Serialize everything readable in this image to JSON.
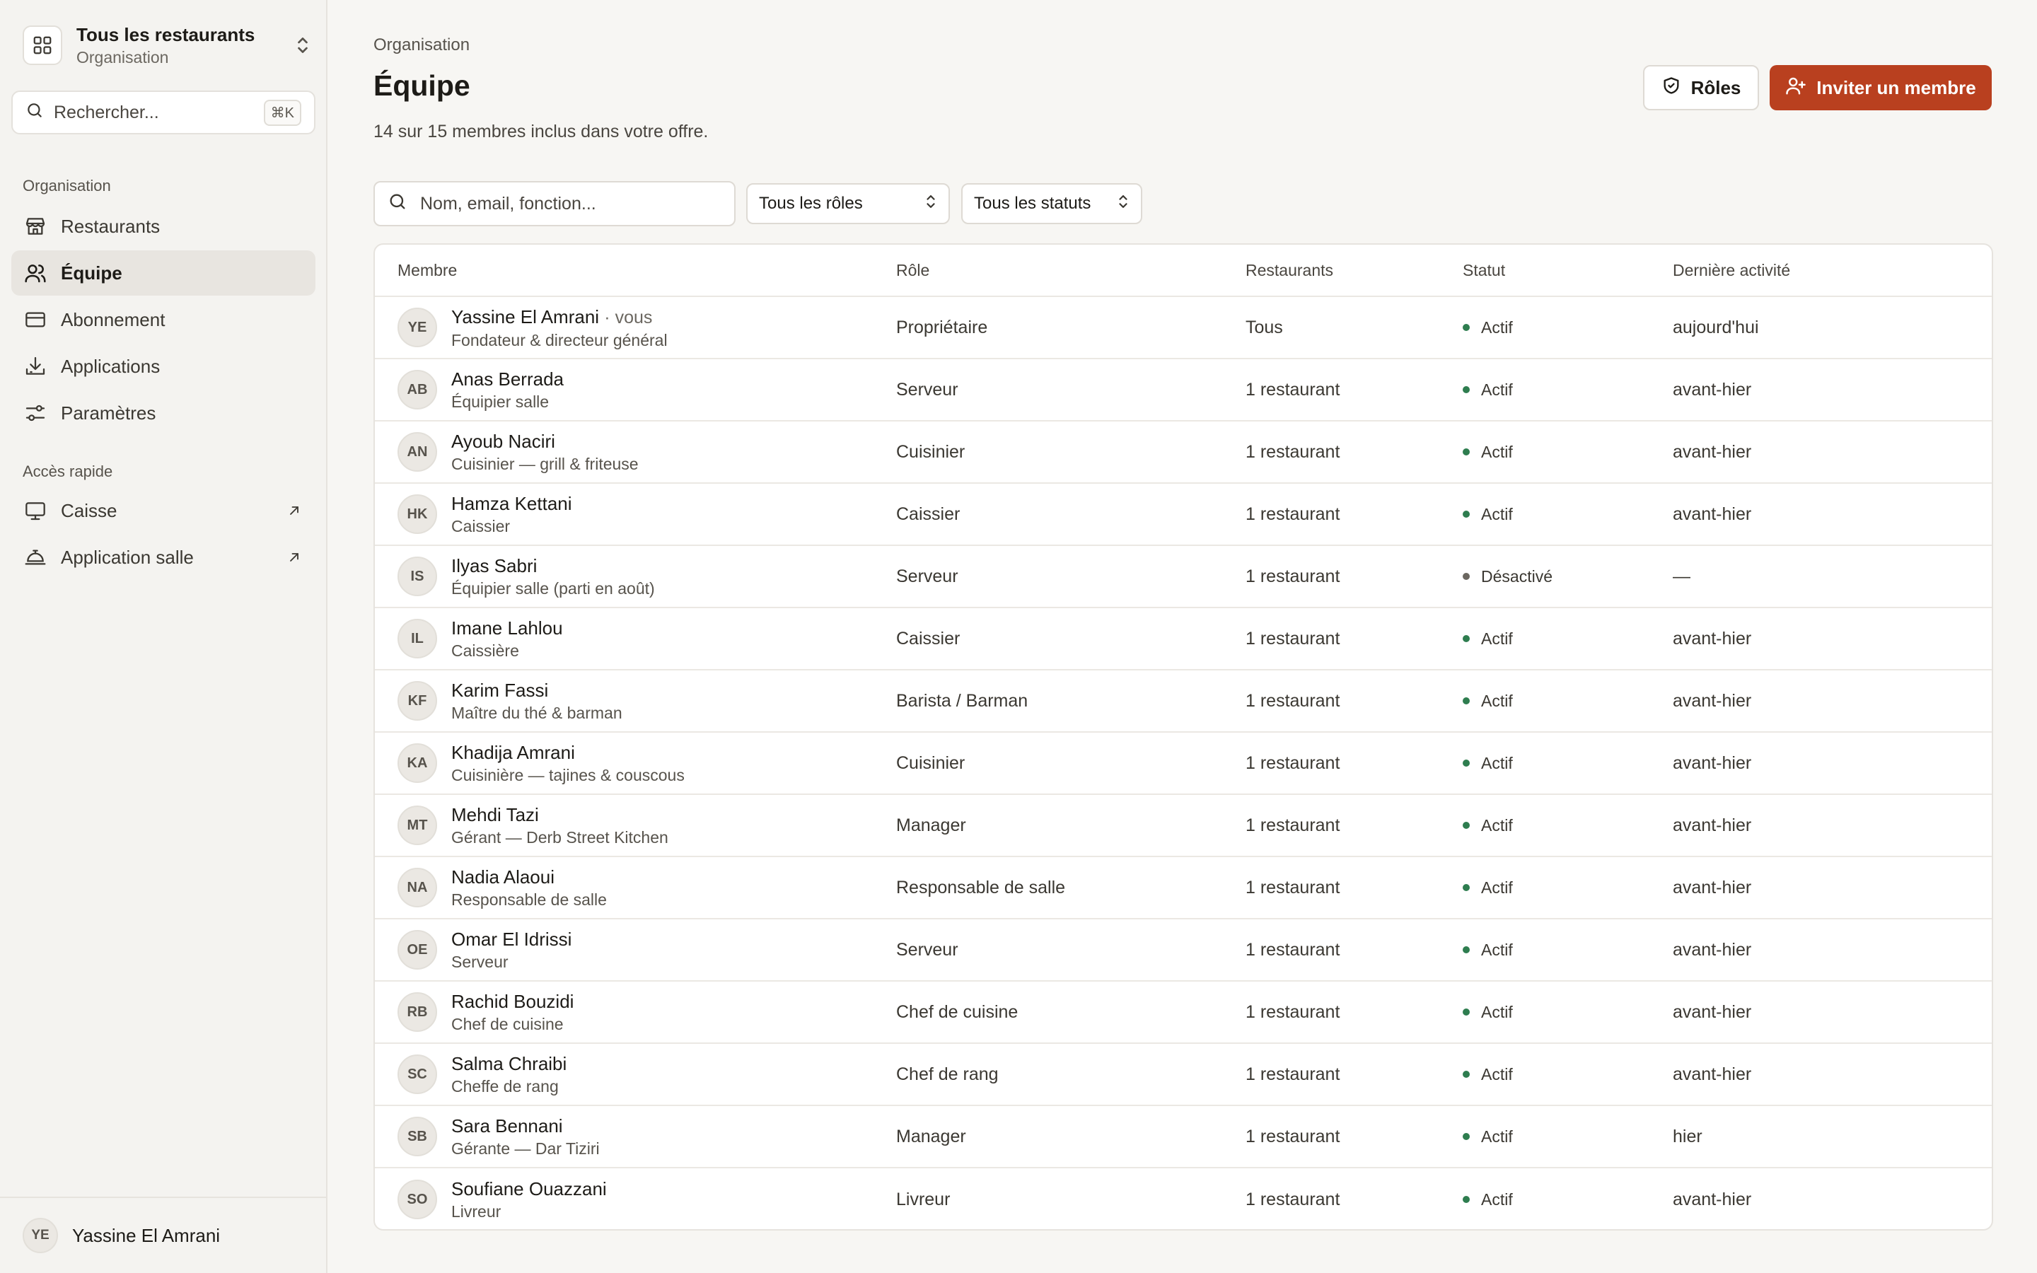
{
  "colors": {
    "accent": "#b9401f",
    "active_dot": "#2e7d4f",
    "inactive_dot": "#6b6760"
  },
  "sidebar": {
    "workspace": {
      "title": "Tous les restaurants",
      "subtitle": "Organisation",
      "icon": "grid-icon"
    },
    "search": {
      "placeholder": "Rechercher...",
      "shortcut": "⌘K"
    },
    "section_org": "Organisation",
    "nav": [
      {
        "label": "Restaurants",
        "icon": "store-icon"
      },
      {
        "label": "Équipe",
        "icon": "users-icon",
        "active": true
      },
      {
        "label": "Abonnement",
        "icon": "credit-card-icon"
      },
      {
        "label": "Applications",
        "icon": "download-icon"
      },
      {
        "label": "Paramètres",
        "icon": "sliders-icon"
      }
    ],
    "section_quick": "Accès rapide",
    "quick": [
      {
        "label": "Caisse",
        "icon": "monitor-icon"
      },
      {
        "label": "Application salle",
        "icon": "cloche-icon"
      }
    ],
    "user": {
      "initials": "YE",
      "name": "Yassine El Amrani"
    }
  },
  "main": {
    "breadcrumb": "Organisation",
    "title": "Équipe",
    "subtitle": "14 sur 15 membres inclus dans votre offre.",
    "roles_button": "Rôles",
    "invite_button": "Inviter un membre",
    "filters": {
      "search_placeholder": "Nom, email, fonction...",
      "role_select": "Tous les rôles",
      "status_select": "Tous les statuts"
    },
    "table": {
      "headers": [
        "Membre",
        "Rôle",
        "Restaurants",
        "Statut",
        "Dernière activité"
      ],
      "rows": [
        {
          "initials": "YE",
          "name": "Yassine El Amrani",
          "you": "· vous",
          "function": "Fondateur & directeur général",
          "role": "Propriétaire",
          "restaurants": "Tous",
          "status": "Actif",
          "activity": "aujourd'hui"
        },
        {
          "initials": "AB",
          "name": "Anas Berrada",
          "function": "Équipier salle",
          "role": "Serveur",
          "restaurants": "1 restaurant",
          "status": "Actif",
          "activity": "avant-hier"
        },
        {
          "initials": "AN",
          "name": "Ayoub Naciri",
          "function": "Cuisinier — grill & friteuse",
          "role": "Cuisinier",
          "restaurants": "1 restaurant",
          "status": "Actif",
          "activity": "avant-hier"
        },
        {
          "initials": "HK",
          "name": "Hamza Kettani",
          "function": "Caissier",
          "role": "Caissier",
          "restaurants": "1 restaurant",
          "status": "Actif",
          "activity": "avant-hier"
        },
        {
          "initials": "IS",
          "name": "Ilyas Sabri",
          "function": "Équipier salle (parti en août)",
          "role": "Serveur",
          "restaurants": "1 restaurant",
          "status": "Désactivé",
          "activity": "—"
        },
        {
          "initials": "IL",
          "name": "Imane Lahlou",
          "function": "Caissière",
          "role": "Caissier",
          "restaurants": "1 restaurant",
          "status": "Actif",
          "activity": "avant-hier"
        },
        {
          "initials": "KF",
          "name": "Karim Fassi",
          "function": "Maître du thé & barman",
          "role": "Barista / Barman",
          "restaurants": "1 restaurant",
          "status": "Actif",
          "activity": "avant-hier"
        },
        {
          "initials": "KA",
          "name": "Khadija Amrani",
          "function": "Cuisinière — tajines & couscous",
          "role": "Cuisinier",
          "restaurants": "1 restaurant",
          "status": "Actif",
          "activity": "avant-hier"
        },
        {
          "initials": "MT",
          "name": "Mehdi Tazi",
          "function": "Gérant — Derb Street Kitchen",
          "role": "Manager",
          "restaurants": "1 restaurant",
          "status": "Actif",
          "activity": "avant-hier"
        },
        {
          "initials": "NA",
          "name": "Nadia Alaoui",
          "function": "Responsable de salle",
          "role": "Responsable de salle",
          "restaurants": "1 restaurant",
          "status": "Actif",
          "activity": "avant-hier"
        },
        {
          "initials": "OE",
          "name": "Omar El Idrissi",
          "function": "Serveur",
          "role": "Serveur",
          "restaurants": "1 restaurant",
          "status": "Actif",
          "activity": "avant-hier"
        },
        {
          "initials": "RB",
          "name": "Rachid Bouzidi",
          "function": "Chef de cuisine",
          "role": "Chef de cuisine",
          "restaurants": "1 restaurant",
          "status": "Actif",
          "activity": "avant-hier"
        },
        {
          "initials": "SC",
          "name": "Salma Chraibi",
          "function": "Cheffe de rang",
          "role": "Chef de rang",
          "restaurants": "1 restaurant",
          "status": "Actif",
          "activity": "avant-hier"
        },
        {
          "initials": "SB",
          "name": "Sara Bennani",
          "function": "Gérante — Dar Tiziri",
          "role": "Manager",
          "restaurants": "1 restaurant",
          "status": "Actif",
          "activity": "hier"
        },
        {
          "initials": "SO",
          "name": "Soufiane Ouazzani",
          "function": "Livreur",
          "role": "Livreur",
          "restaurants": "1 restaurant",
          "status": "Actif",
          "activity": "avant-hier"
        }
      ]
    }
  }
}
